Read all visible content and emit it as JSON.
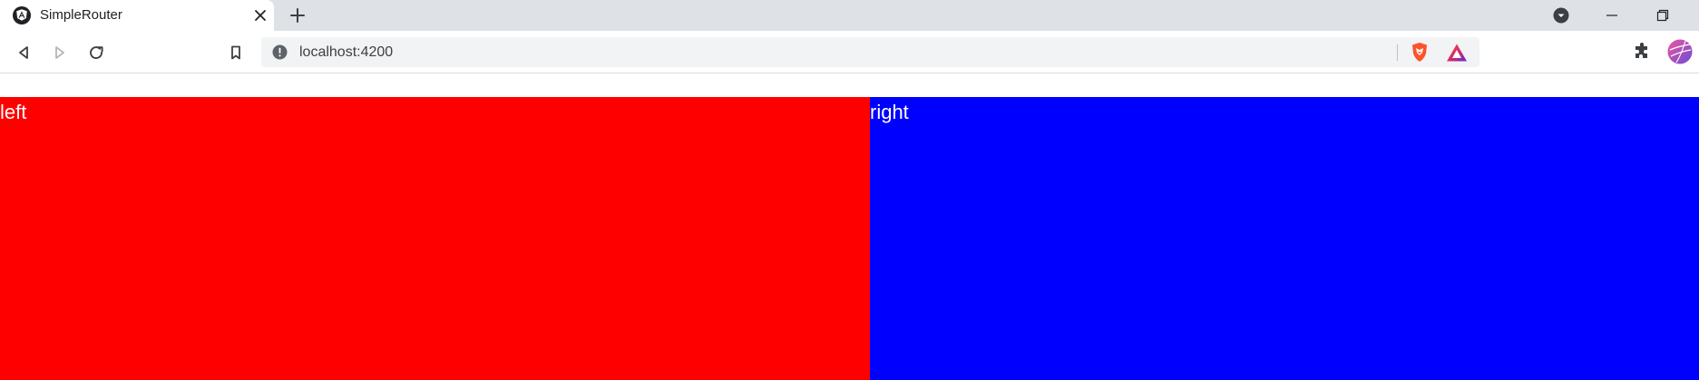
{
  "tab": {
    "title": "SimpleRouter",
    "favicon_icon": "angular-icon"
  },
  "window_controls": {
    "tab_search_icon": "chevron-down-circle-icon",
    "minimize_icon": "minimize-icon",
    "restore_icon": "restore-icon"
  },
  "toolbar": {
    "url": "localhost:4200",
    "info_icon": "info-icon",
    "back_icon": "back-icon",
    "forward_icon": "forward-icon",
    "reload_icon": "reload-icon",
    "bookmark_icon": "bookmark-icon",
    "shield_icon": "brave-shield-icon",
    "rewards_icon": "brave-rewards-icon",
    "extensions_icon": "puzzle-icon",
    "profile_icon": "avatar-icon"
  },
  "page": {
    "left": {
      "label": "left",
      "color": "#ff0000"
    },
    "right": {
      "label": "right",
      "color": "#0000ff"
    }
  }
}
